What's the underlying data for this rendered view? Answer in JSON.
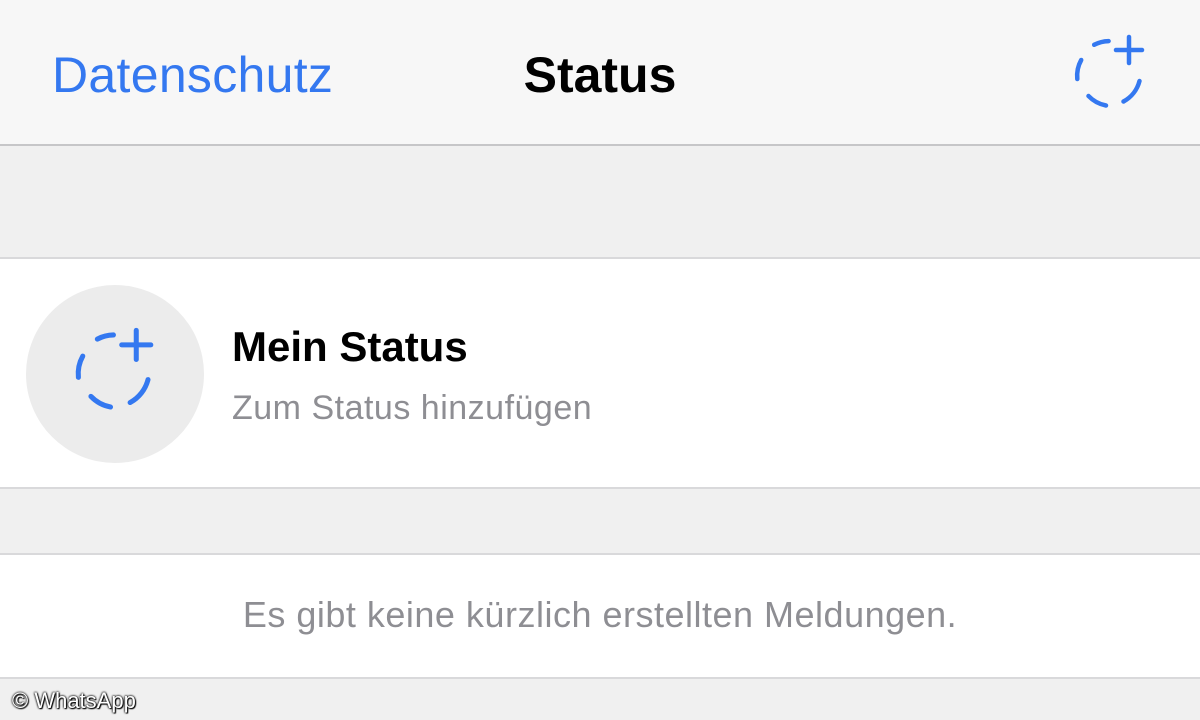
{
  "nav": {
    "back_label": "Datenschutz",
    "title": "Status",
    "action_icon": "add-status-icon"
  },
  "my_status": {
    "title": "Mein Status",
    "subtitle": "Zum Status hinzufügen",
    "icon": "add-status-icon"
  },
  "empty_message": "Es gibt keine kürzlich erstellten Meldungen.",
  "watermark": "© WhatsApp",
  "colors": {
    "accent": "#3478f0",
    "secondary_text": "#8e8e93",
    "background": "#f0f0f0"
  }
}
